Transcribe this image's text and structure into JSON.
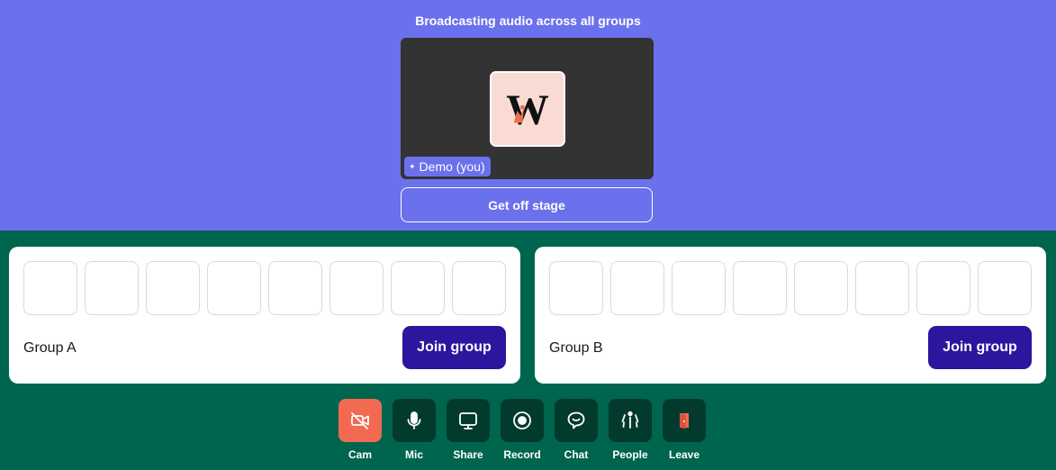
{
  "stage": {
    "title": "Broadcasting audio across all groups",
    "participant_name": "Demo (you)",
    "avatar_icon": "w-logo-icon",
    "get_off_stage_label": "Get off stage"
  },
  "groups": [
    {
      "name": "Group A",
      "join_label": "Join group"
    },
    {
      "name": "Group B",
      "join_label": "Join group"
    }
  ],
  "toolbar": {
    "items": [
      {
        "label": "Cam",
        "icon": "camera-off-icon",
        "color": "#f26a52"
      },
      {
        "label": "Mic",
        "icon": "microphone-icon"
      },
      {
        "label": "Share",
        "icon": "screen-share-icon"
      },
      {
        "label": "Record",
        "icon": "record-icon"
      },
      {
        "label": "Chat",
        "icon": "chat-icon"
      },
      {
        "label": "People",
        "icon": "people-icon"
      },
      {
        "label": "Leave",
        "icon": "leave-door-icon",
        "color": "#f26a52"
      }
    ]
  },
  "colors": {
    "stage_bg": "#6b70ec",
    "room_bg": "#00654f",
    "join_button": "#2d159e",
    "toolbar_button": "#033a2e",
    "alert": "#f26a52"
  }
}
